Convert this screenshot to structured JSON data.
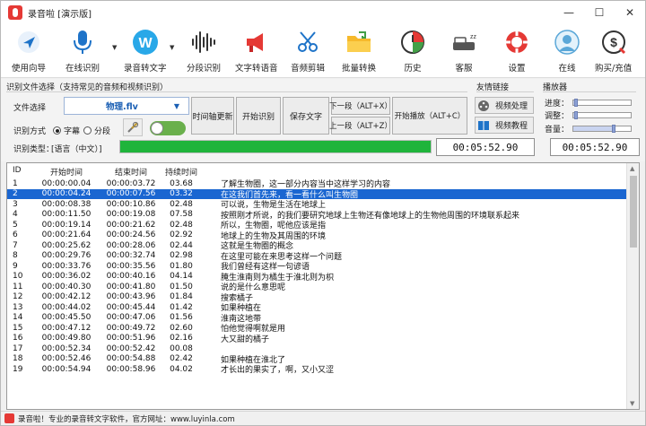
{
  "window": {
    "title": "录音啦 [演示版]"
  },
  "toolbar": {
    "items": [
      {
        "label": "使用向导",
        "icon": "navigation-arrow-icon"
      },
      {
        "label": "在线识别",
        "icon": "microphone-icon"
      },
      {
        "label": "录音转文字",
        "icon": "record-to-text-icon"
      },
      {
        "label": "分段识别",
        "icon": "waveform-icon"
      },
      {
        "label": "文字转语音",
        "icon": "megaphone-icon"
      },
      {
        "label": "音频剪辑",
        "icon": "scissors-icon"
      },
      {
        "label": "批量转换",
        "icon": "folder-icon"
      },
      {
        "label": "历史",
        "icon": "history-clock-icon"
      },
      {
        "label": "客服",
        "icon": "customer-service-icon"
      },
      {
        "label": "设置",
        "icon": "lifebuoy-icon"
      },
      {
        "label": "在线",
        "icon": "user-online-icon"
      },
      {
        "label": "购买/充值",
        "icon": "dollar-coin-icon"
      }
    ]
  },
  "recognition": {
    "group_title": "识别文件选择（支持常见的音频和视频识别）",
    "file_label": "文件选择",
    "file_value": "物理.flv",
    "mode_label": "识别方式",
    "mode_subtitle": "字幕",
    "mode_segment": "分段",
    "type_label": "识别类型：",
    "type_value": "[语言（中文）]",
    "progress": 1.0
  },
  "buttons": {
    "timeline_update": "时间轴更新",
    "start_recognize": "开始识别",
    "save_text": "保存文字",
    "next_segment": "下一段（ALT+X）",
    "prev_segment": "上一段（ALT+Z）",
    "start_play": "开始播放（ALT+C）"
  },
  "friendly_links": {
    "title": "友情链接",
    "video_process": "视频处理",
    "video_tutorial": "视频教程"
  },
  "player": {
    "title": "播放器",
    "progress_label": "进度：",
    "adjust_label": "调整：",
    "volume_label": "音量：",
    "progress_value": 0.05,
    "adjust_value": 0.05,
    "volume_value": 0.7
  },
  "times": {
    "current": "00:05:52.90",
    "total": "00:05:52.90"
  },
  "table": {
    "columns": [
      "ID",
      "开始时间",
      "结束时间",
      "持续时间",
      ""
    ],
    "rows": [
      [
        "1",
        "00:00:00.04",
        "00:00:03.72",
        "03.68",
        "了解生物圈，这一部分内容当中这样学习的内容"
      ],
      [
        "2",
        "00:00:04.24",
        "00:00:07.56",
        "03.32",
        "在这我们首先来，看一看什么叫生物圈"
      ],
      [
        "3",
        "00:00:08.38",
        "00:00:10.86",
        "02.48",
        "可以说，生物是生活在地球上"
      ],
      [
        "4",
        "00:00:11.50",
        "00:00:19.08",
        "07.58",
        "按照刚才所说，的我们要研究地球上生物还有像地球上的生物他周围的环境联系起来"
      ],
      [
        "5",
        "00:00:19.14",
        "00:00:21.62",
        "02.48",
        "所以，生物圈，呢他应该是指"
      ],
      [
        "6",
        "00:00:21.64",
        "00:00:24.56",
        "02.92",
        "地球上的生物及其周围的环境"
      ],
      [
        "7",
        "00:00:25.62",
        "00:00:28.06",
        "02.44",
        "这就是生物圈的概念"
      ],
      [
        "8",
        "00:00:29.76",
        "00:00:32.74",
        "02.98",
        "在这里可能在来思考这样一个问题"
      ],
      [
        "9",
        "00:00:33.76",
        "00:00:35.56",
        "01.80",
        "我们曾经有这样一句谚语"
      ],
      [
        "10",
        "00:00:36.02",
        "00:00:40.16",
        "04.14",
        "腌生淮南则为橘生于淮北则为枳"
      ],
      [
        "11",
        "00:00:40.30",
        "00:00:41.80",
        "01.50",
        "说的是什么意思呢"
      ],
      [
        "12",
        "00:00:42.12",
        "00:00:43.96",
        "01.84",
        "搜索橘子"
      ],
      [
        "13",
        "00:00:44.02",
        "00:00:45.44",
        "01.42",
        "如果种植在"
      ],
      [
        "14",
        "00:00:45.50",
        "00:00:47.06",
        "01.56",
        "淮南这地带"
      ],
      [
        "15",
        "00:00:47.12",
        "00:00:49.72",
        "02.60",
        "怕他觉得啊就是用"
      ],
      [
        "16",
        "00:00:49.80",
        "00:00:51.96",
        "02.16",
        "大又甜的橘子"
      ],
      [
        "17",
        "00:00:52.34",
        "00:00:52.42",
        "00.08",
        ""
      ],
      [
        "18",
        "00:00:52.46",
        "00:00:54.88",
        "02.42",
        "如果种植在淮北了"
      ],
      [
        "19",
        "00:00:54.94",
        "00:00:58.96",
        "04.02",
        "才长出的果实了，啊，又小又涩"
      ]
    ],
    "selected_index": 1
  },
  "status": {
    "text": "录音啦！专业的录音转文字软件，官方网址：www.luyinla.com"
  },
  "colors": {
    "selection": "#1a66d1",
    "progress": "#1fb43b",
    "accent_blue": "#1a5fb4"
  }
}
